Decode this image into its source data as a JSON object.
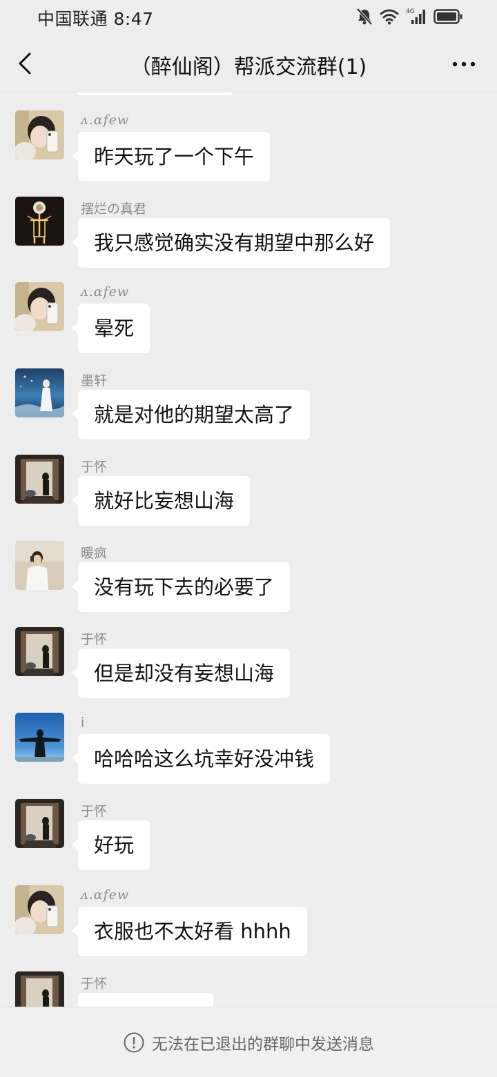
{
  "status_bar": {
    "carrier_time": "中国联通 8:47",
    "network": "4G"
  },
  "header": {
    "title": "（醉仙阁）帮派交流群(1)"
  },
  "messages": [
    {
      "sender": "ᴧ.ɑfew",
      "text": "昨天玩了一个下午",
      "avatar": "girl-phone-selfie"
    },
    {
      "sender": "摆烂の真君",
      "text": "我只感觉确实没有期望中那么好",
      "avatar": "glowing-figure"
    },
    {
      "sender": "ᴧ.ɑfew",
      "text": "晕死",
      "avatar": "girl-phone-selfie"
    },
    {
      "sender": "墨轩",
      "text": "就是对他的期望太高了",
      "avatar": "ocean-figure"
    },
    {
      "sender": "于怀",
      "text": "就好比妄想山海",
      "avatar": "doorway-motorcycle"
    },
    {
      "sender": "暖疯",
      "text": "没有玩下去的必要了",
      "avatar": "boy-white-shirt"
    },
    {
      "sender": "于怀",
      "text": "但是却没有妄想山海",
      "avatar": "doorway-motorcycle"
    },
    {
      "sender": "i",
      "text": "哈哈哈这么坑幸好没冲钱",
      "avatar": "silhouette-sky"
    },
    {
      "sender": "于怀",
      "text": "好玩",
      "avatar": "doorway-motorcycle"
    },
    {
      "sender": "ᴧ.ɑfew",
      "text": "衣服也不太好看 hhhh",
      "avatar": "girl-phone-selfie"
    },
    {
      "sender": "于怀",
      "text": "",
      "avatar": "doorway-motorcycle"
    }
  ],
  "footer": {
    "notice": "无法在已退出的群聊中发送消息",
    "icon": "info-circle-icon"
  },
  "colors": {
    "background": "#ededed",
    "bubble": "#ffffff",
    "name": "#8a8a8a"
  }
}
